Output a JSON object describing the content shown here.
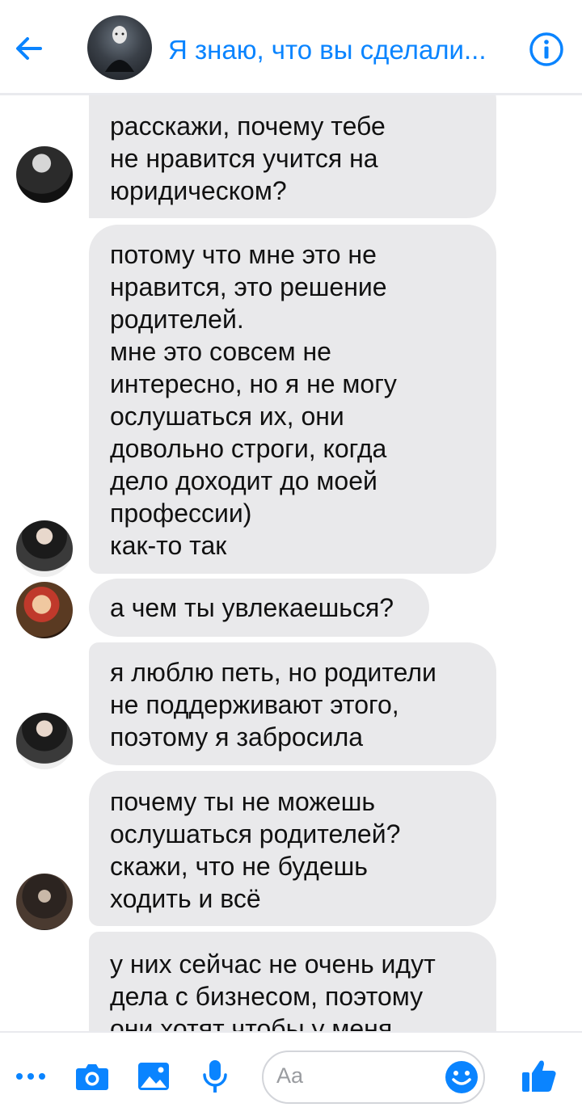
{
  "header": {
    "title": "Я знаю, что вы сделали..."
  },
  "messages": [
    {
      "text": "расскажи, почему тебе\nне нравится учится на\nюридическом?"
    },
    {
      "text": "потому что мне это не\nнравится, это решение\nродителей.\nмне это совсем не\nинтересно, но я не могу\nослушаться их, они\nдовольно строги, когда\nдело доходит до моей\nпрофессии)\nкак-то так"
    },
    {
      "text": "а чем ты увлекаешься?"
    },
    {
      "text": "я люблю петь, но родители\nне поддерживают этого,\nпоэтому я забросила"
    },
    {
      "text": "почему ты не можешь\nослушаться родителей?\nскажи, что не будешь\nходить и всё"
    },
    {
      "text": "у них сейчас не очень идут\nдела с бизнесом, поэтому\nони хотят чтобы у меня"
    }
  ],
  "composer": {
    "placeholder": "Aa"
  },
  "colors": {
    "accent": "#0a84ff",
    "bubble": "#e9e9eb"
  }
}
